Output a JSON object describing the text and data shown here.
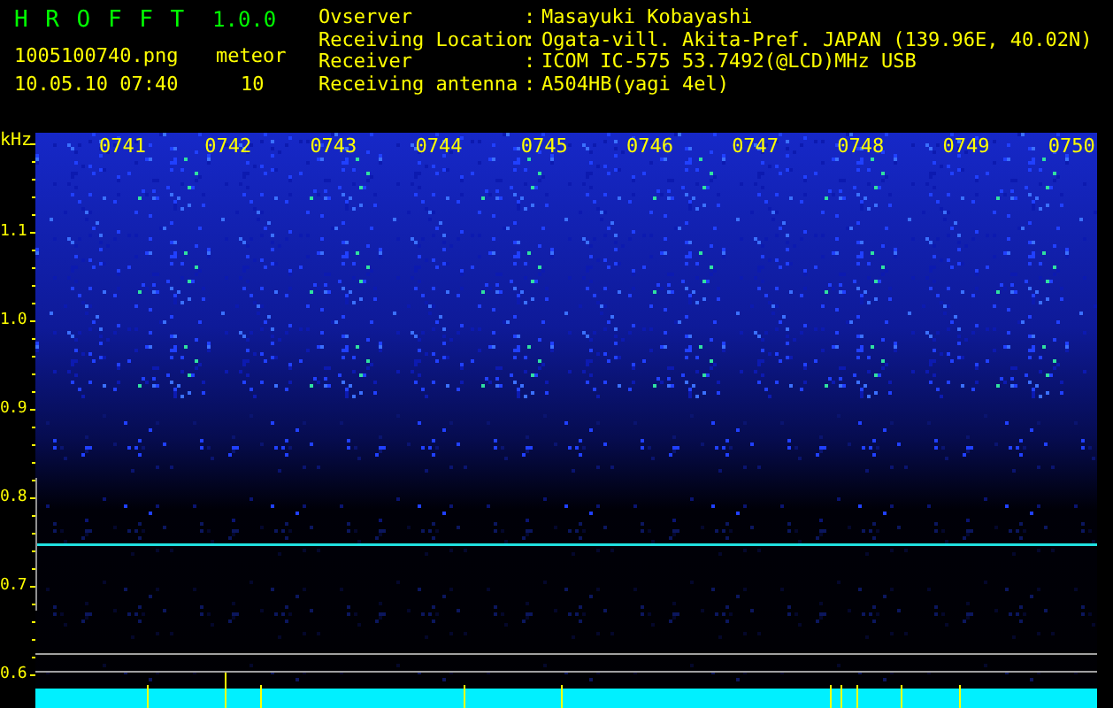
{
  "app": {
    "name": "H R O F F T",
    "version": "1.0.0",
    "file": "1005100740.png",
    "datetime": "10.05.10 07:40",
    "count_label": "meteor",
    "count": "10"
  },
  "station": [
    {
      "label": "Ovserver",
      "separator": ":",
      "value": "Masayuki Kobayashi"
    },
    {
      "label": "Receiving Location",
      "separator": ":",
      "value": "Ogata-vill. Akita-Pref. JAPAN (139.96E, 40.02N)"
    },
    {
      "label": "Receiver",
      "separator": ":",
      "value": "ICOM IC-575 53.7492(@LCD)MHz USB"
    },
    {
      "label": "Receiving antenna",
      "separator": ":",
      "value": "A504HB(yagi 4el)"
    }
  ],
  "plot": {
    "unit": "kHz",
    "y_labels": [
      "1.1",
      "1.0",
      "0.9",
      "0.8",
      "0.7",
      "0.6"
    ],
    "time_labels": [
      "0741",
      "0742",
      "0743",
      "0744",
      "0745",
      "0746",
      "0747",
      "0748",
      "0749",
      "0750"
    ]
  }
}
